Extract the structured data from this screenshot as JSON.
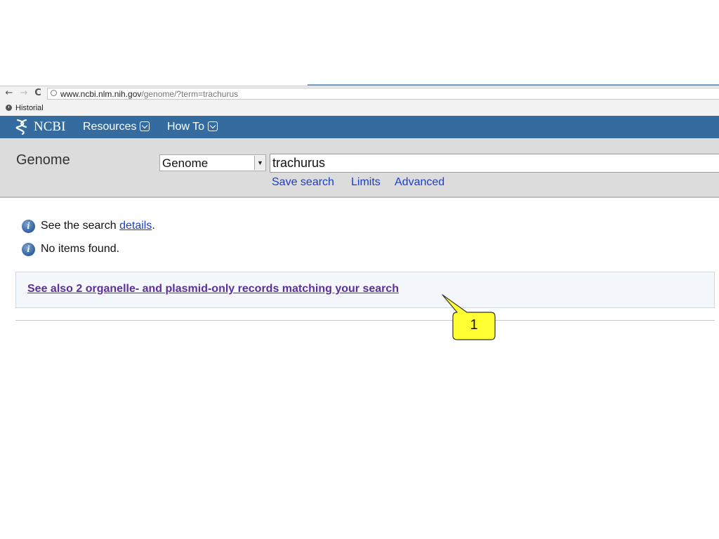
{
  "browser": {
    "back_glyph": "←",
    "forward_glyph": "→",
    "reload_glyph": "C",
    "url_host": "www.ncbi.nlm.nih.gov",
    "url_path": "/genome/?term=trachurus",
    "bookmarks": [
      {
        "label": "Historial"
      }
    ]
  },
  "header": {
    "logo_text": "NCBI",
    "menus": [
      {
        "label": "Resources"
      },
      {
        "label": "How To"
      }
    ]
  },
  "search": {
    "database_title": "Genome",
    "database_selected": "Genome",
    "term": "trachurus",
    "links": [
      {
        "label": "Save search"
      },
      {
        "label": "Limits"
      },
      {
        "label": "Advanced"
      }
    ]
  },
  "messages": {
    "details_prefix": "See the search ",
    "details_link": "details",
    "details_suffix": ".",
    "no_items": "No items found.",
    "see_also": "See also 2 organelle- and plasmid-only records matching your search"
  },
  "callout": {
    "label": "1",
    "fill_color": "#ffff33"
  },
  "colors": {
    "header_bar": "#346c9f",
    "link": "#1a3ec9",
    "visited_link": "#5c3196"
  }
}
